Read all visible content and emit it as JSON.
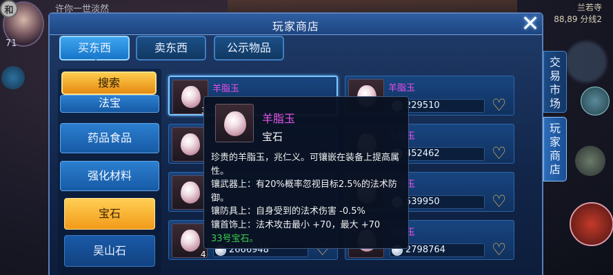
{
  "player": {
    "badge": "和",
    "level": "71",
    "name": "许你一世淡然"
  },
  "location": {
    "map": "兰若寺",
    "coords_channel": "88,89 分线2"
  },
  "shop": {
    "title": "玩家商店",
    "tabs": [
      "买东西",
      "卖东西",
      "公示物品"
    ],
    "active_tab": 0,
    "search_label": "搜索",
    "categories": [
      "法宝",
      "药品食品",
      "强化材料"
    ],
    "subcategories": [
      "宝石",
      "吴山石"
    ],
    "active_subcategory": 0,
    "side_tabs": [
      "交易市场",
      "玩家商店"
    ],
    "active_side_tab": 1
  },
  "items": [
    {
      "name": "羊脂玉",
      "qty": "3",
      "price": "",
      "selected": true
    },
    {
      "name": "羊脂玉",
      "qty": "",
      "price": "229510",
      "selected": false
    },
    {
      "name": "",
      "qty": "",
      "price": "",
      "selected": false
    },
    {
      "name": "羊脂玉",
      "qty": "",
      "price": "452462",
      "selected": false
    },
    {
      "name": "",
      "qty": "",
      "price": "",
      "selected": false
    },
    {
      "name": "羊脂玉",
      "qty": "",
      "price": "539950",
      "selected": false
    },
    {
      "name": "",
      "qty": "4",
      "price": "2666948",
      "selected": false
    },
    {
      "name": "羊脂玉",
      "qty": "",
      "price": "2798764",
      "selected": false
    }
  ],
  "tooltip": {
    "name": "羊脂玉",
    "type": "宝石",
    "lines": [
      "珍贵的羊脂玉，兆仁义。可镶嵌在装备上提高属性。",
      "镶武器上：有20%概率忽视目标2.5%的法术防御。",
      "镶防具上：自身受到的法术伤害 -0.5%",
      "镶首饰上：法术攻击最小 +70，最大 +70"
    ],
    "footer": "33号宝石。"
  },
  "colors": {
    "item_name": "#e24ee8",
    "accent_gold": "#f29a18",
    "tooltip_footer": "#39d24a"
  }
}
